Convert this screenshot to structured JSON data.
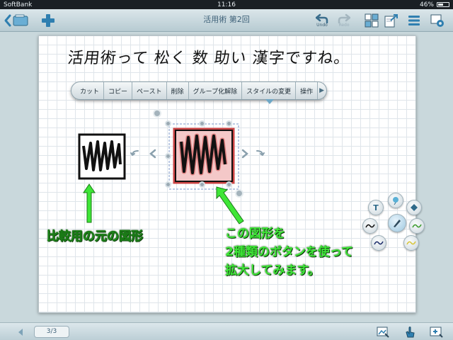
{
  "status_bar": {
    "carrier": "SoftBank",
    "time": "11:16",
    "battery": "46%"
  },
  "toolbar": {
    "title": "活用術 第2回",
    "undo_label": "Undo",
    "redo_label": "Redo"
  },
  "canvas": {
    "handwriting": "活用術って 松く 数 助い 漢字ですね。"
  },
  "context_menu": {
    "items": [
      "カット",
      "コピー",
      "ペースト",
      "削除",
      "グループ化解除",
      "スタイルの変更",
      "操作"
    ]
  },
  "annotations": {
    "original_label": "比較用の元の図形",
    "selected_label_lines": [
      "この図形を",
      "2種類のボタンを使って",
      "拡大してみます。"
    ]
  },
  "bottom_bar": {
    "page_indicator": "3/3"
  },
  "colors": {
    "accent_green": "#3ee637",
    "toolbar_text": "#3d6078",
    "selection_blue": "#7a94c8",
    "selected_fill": "#f4c8c8"
  },
  "icons": {
    "back": "notebook-back-icon",
    "new": "plus-icon",
    "undo": "undo-icon",
    "redo": "redo-icon",
    "grid": "page-grid-icon",
    "export": "export-icon",
    "menu": "menu-icon",
    "settings": "settings-icon"
  }
}
